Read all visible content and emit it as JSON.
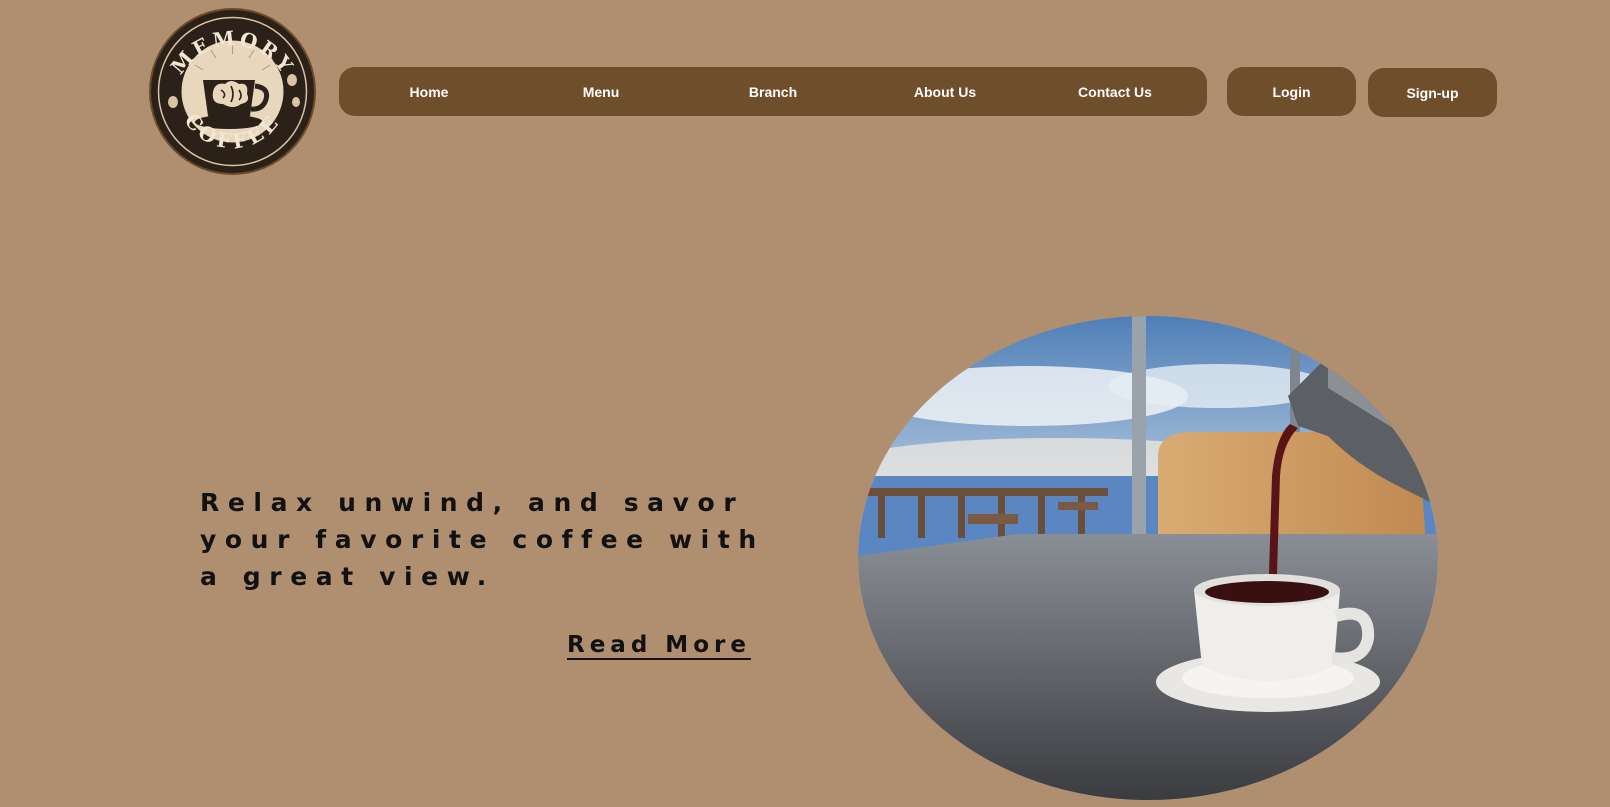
{
  "brand": {
    "logo_top_text": "MEMORY",
    "logo_bottom_text": "COFFEE",
    "logo_icon": "coffee-cup-brain-icon"
  },
  "nav": {
    "items": [
      {
        "label": "Home"
      },
      {
        "label": "Menu"
      },
      {
        "label": "Branch"
      },
      {
        "label": "About Us"
      },
      {
        "label": "Contact Us"
      }
    ]
  },
  "auth": {
    "login_label": "Login",
    "signup_label": "Sign-up"
  },
  "hero": {
    "tagline": "Relax unwind, and savor your favorite coffee with a great view.",
    "read_more_label": "Read More",
    "image_subject": "coffee-pouring-scenic-view"
  },
  "colors": {
    "background": "#B08E70",
    "nav_bg": "#6F4E2C",
    "text_dark": "#111111",
    "nav_text": "#FFFFFF"
  }
}
